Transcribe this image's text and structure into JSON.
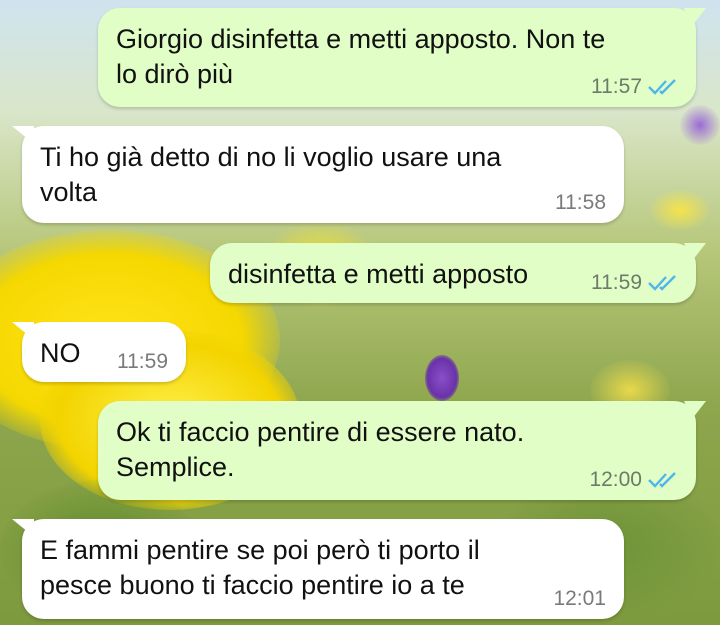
{
  "chat": {
    "messages": [
      {
        "direction": "out",
        "text": "Giorgio disinfetta e metti apposto. Non te\nlo dirò più",
        "time": "11:57",
        "status": "read"
      },
      {
        "direction": "in",
        "text": "Ti ho già detto di no li voglio usare una\nvolta",
        "time": "11:58"
      },
      {
        "direction": "out",
        "text": "disinfetta e metti apposto",
        "time": "11:59",
        "status": "read"
      },
      {
        "direction": "in",
        "text": "NO",
        "time": "11:59"
      },
      {
        "direction": "out",
        "text": "Ok ti faccio pentire di essere nato.\nSemplice.",
        "time": "12:00",
        "status": "read"
      },
      {
        "direction": "in",
        "text": "E fammi pentire se poi però ti porto il\npesce buono ti faccio pentire io a te",
        "time": "12:01"
      }
    ]
  },
  "colors": {
    "outgoing_bubble": "#e1fec6",
    "incoming_bubble": "#ffffff",
    "read_ticks": "#4fb6ec"
  },
  "icons": {
    "read_receipt": "double-check-icon"
  }
}
